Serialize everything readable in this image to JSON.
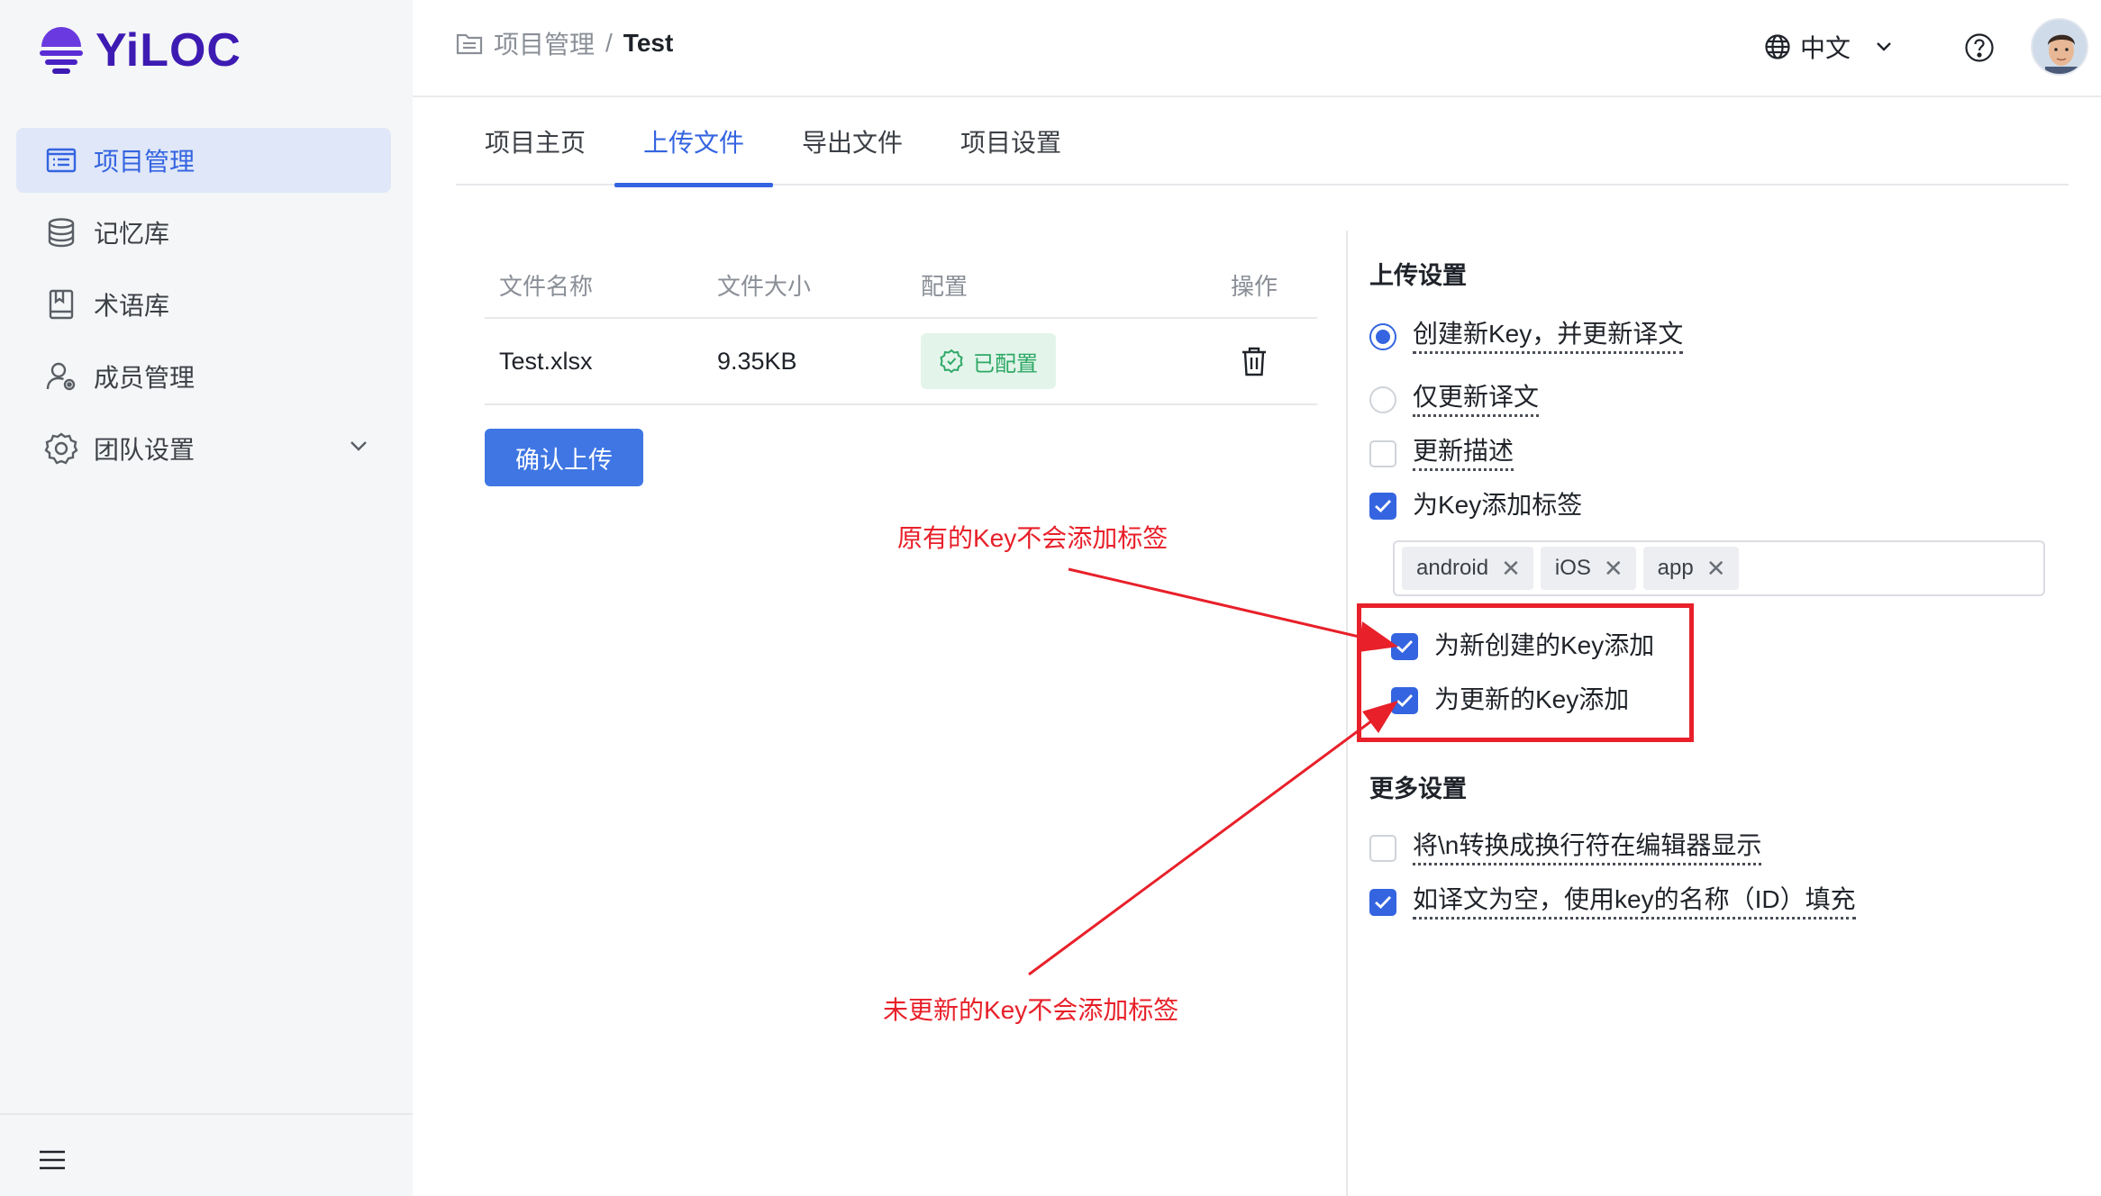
{
  "brand": {
    "name": "YiLOC"
  },
  "sidebar": {
    "items": [
      {
        "label": "项目管理",
        "icon": "project-list-icon",
        "active": true
      },
      {
        "label": "记忆库",
        "icon": "database-icon",
        "active": false
      },
      {
        "label": "术语库",
        "icon": "book-icon",
        "active": false
      },
      {
        "label": "成员管理",
        "icon": "member-settings-icon",
        "active": false
      },
      {
        "label": "团队设置",
        "icon": "gear-icon",
        "active": false,
        "expandable": true
      }
    ]
  },
  "header": {
    "breadcrumb": {
      "parent": "项目管理",
      "separator": "/",
      "current": "Test"
    },
    "language": "中文"
  },
  "tabs": [
    {
      "label": "项目主页",
      "active": false
    },
    {
      "label": "上传文件",
      "active": true
    },
    {
      "label": "导出文件",
      "active": false
    },
    {
      "label": "项目设置",
      "active": false
    }
  ],
  "file_table": {
    "columns": [
      "文件名称",
      "文件大小",
      "配置",
      "操作"
    ],
    "rows": [
      {
        "name": "Test.xlsx",
        "size": "9.35KB",
        "config": "已配置"
      }
    ]
  },
  "confirm_button": "确认上传",
  "upload_settings": {
    "title": "上传设置",
    "radio_create": "创建新Key，并更新译文",
    "radio_update": "仅更新译文",
    "update_desc": "更新描述",
    "add_tags": "为Key添加标签",
    "tags": [
      "android",
      "iOS",
      "app"
    ],
    "tag_new_keys": "为新创建的Key添加",
    "tag_updated_keys": "为更新的Key添加"
  },
  "more_settings": {
    "title": "更多设置",
    "newline_convert": "将\\n转换成换行符在编辑器显示",
    "fill_empty": "如译文为空，使用key的名称（ID）填充"
  },
  "annotations": {
    "top": "原有的Key不会添加标签",
    "bottom": "未更新的Key不会添加标签"
  },
  "colors": {
    "accent": "#3464e0",
    "annotation_red": "#e8202a",
    "success_green": "#2ea866",
    "brand_purple": "#3d1bb3"
  }
}
